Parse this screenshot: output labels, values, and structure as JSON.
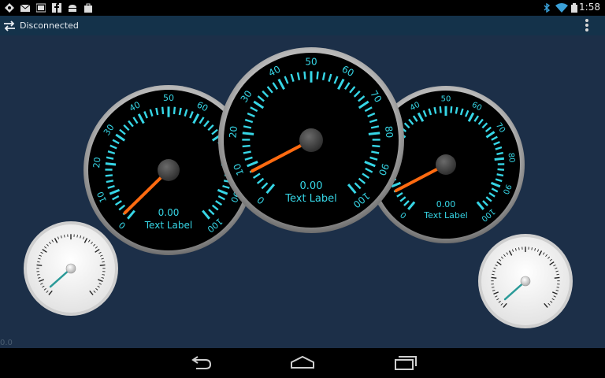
{
  "status_bar": {
    "time": "1:58",
    "left_icons": [
      "location-icon",
      "mail-icon",
      "image-icon",
      "facebook-icon",
      "android-icon",
      "shop-icon"
    ],
    "right_icons": [
      "bluetooth-icon",
      "wifi-icon",
      "battery-icon"
    ]
  },
  "action_bar": {
    "connection_icon": "connection-arrows-icon",
    "status": "Disconnected",
    "menu_icon": "overflow-menu-icon"
  },
  "gauges": {
    "left": {
      "value": "0.00",
      "label": "Text Label",
      "ticks": [
        "0",
        "10",
        "20",
        "30",
        "40",
        "50",
        "60",
        "70",
        "80",
        "90",
        "100"
      ],
      "needle_value": 2
    },
    "center": {
      "value": "0.00",
      "label": "Text Label",
      "ticks": [
        "0",
        "10",
        "20",
        "30",
        "40",
        "50",
        "60",
        "70",
        "80",
        "90",
        "100"
      ],
      "needle_value": 8
    },
    "right": {
      "value": "0.00",
      "label": "Text Label",
      "ticks": [
        "0",
        "10",
        "20",
        "30",
        "40",
        "50",
        "60",
        "70",
        "80",
        "90",
        "100"
      ],
      "needle_value": 8
    },
    "small_left": {
      "needle_value": 3
    },
    "small_right": {
      "needle_value": 3
    },
    "colors": {
      "accent": "#36d6e6",
      "needle": "#ff6a10",
      "small_needle": "#2a9a98"
    }
  },
  "corner_label": "0.0",
  "nav_bar": {
    "back_icon": "back-icon",
    "home_icon": "home-icon",
    "recents_icon": "recents-icon"
  }
}
